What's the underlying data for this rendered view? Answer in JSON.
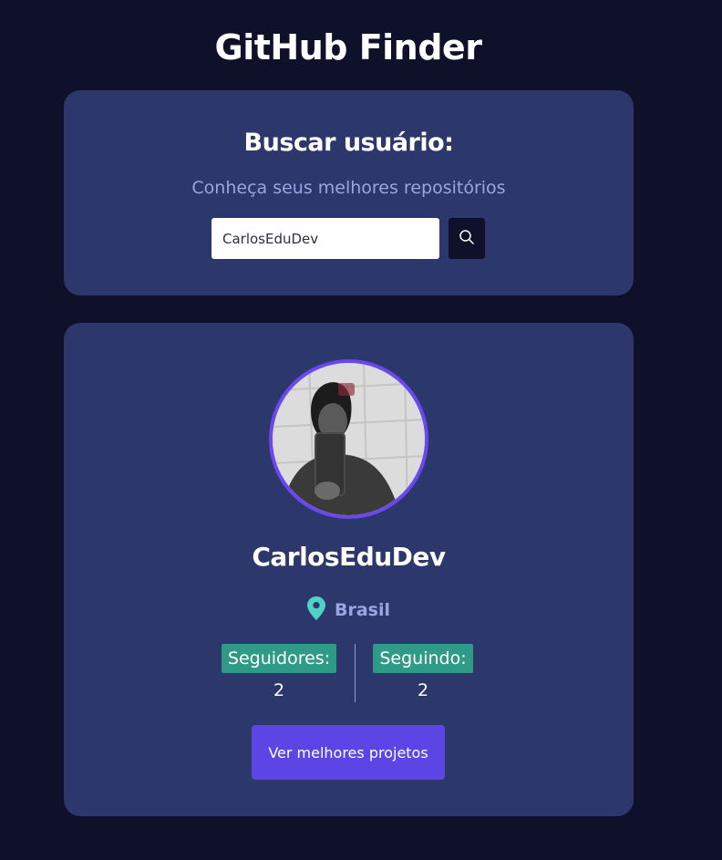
{
  "app": {
    "title": "GitHub Finder"
  },
  "search": {
    "heading": "Buscar usuário:",
    "subtitle": "Conheça seus melhores repositórios",
    "input_value": "CarlosEduDev",
    "button_icon": "search-icon"
  },
  "profile": {
    "avatar": "user-avatar-photo",
    "name": "CarlosEduDev",
    "location_icon": "map-pin-icon",
    "location": "Brasil",
    "followers_label": "Seguidores:",
    "followers_count": "2",
    "following_label": "Seguindo:",
    "following_count": "2",
    "projects_button": "Ver melhores projetos"
  },
  "colors": {
    "background": "#0f112b",
    "card": "#2c376b",
    "accent": "#5b45e4",
    "avatar_border": "#6b47f0",
    "stat_badge": "#2f9a86",
    "location_pin": "#4fd1c5",
    "muted_text": "#9aa6e0"
  }
}
